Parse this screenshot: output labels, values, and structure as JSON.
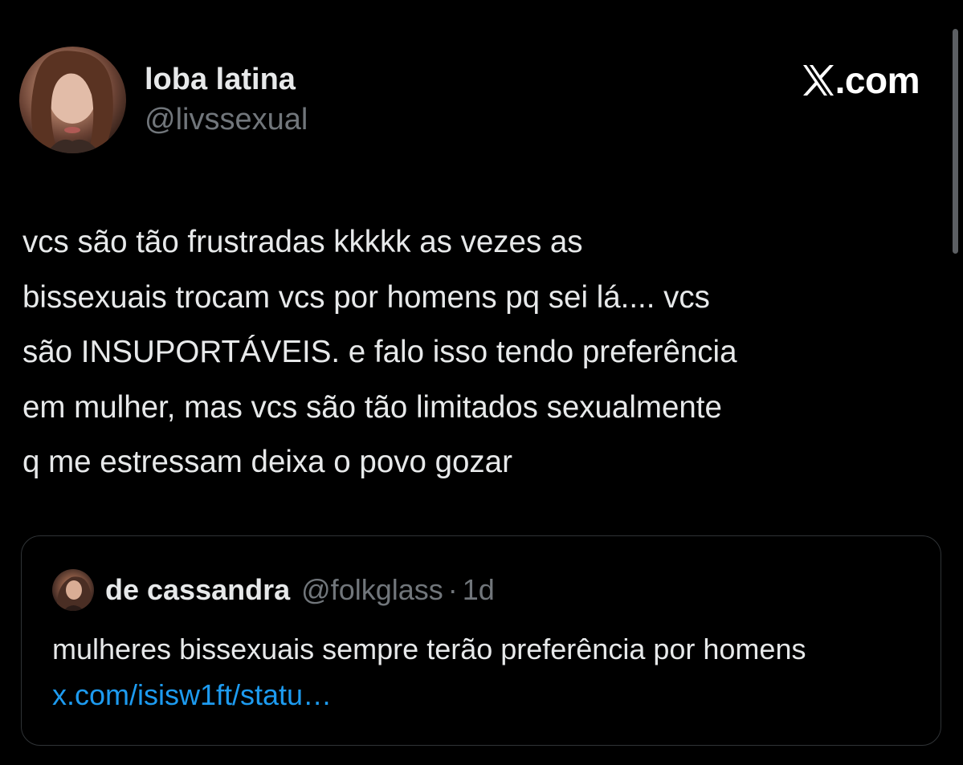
{
  "author": {
    "display_name": "loba latina",
    "handle": "@livssexual",
    "avatar_icon": "profile-photo"
  },
  "brand": {
    "text": ".com",
    "logo_icon": "x-logo-icon"
  },
  "tweet": {
    "text": "vcs são tão frustradas kkkkk as vezes as\nbissexuais trocam vcs por homens pq sei lá.... vcs\nsão INSUPORTÁVEIS. e falo isso tendo preferência\nem mulher, mas vcs são tão limitados sexualmente\nq me estressam deixa o povo gozar"
  },
  "quoted": {
    "display_name": "de cassandra",
    "handle": "@folkglass",
    "separator": "·",
    "time": "1d",
    "text": "mulheres bissexuais sempre terão preferência por homens ",
    "link": "x.com/isisw1ft/statu…"
  },
  "colors": {
    "background": "#000000",
    "text": "#e7e9ea",
    "muted": "#71767b",
    "link": "#1d9bf0",
    "border": "#2f3336"
  }
}
